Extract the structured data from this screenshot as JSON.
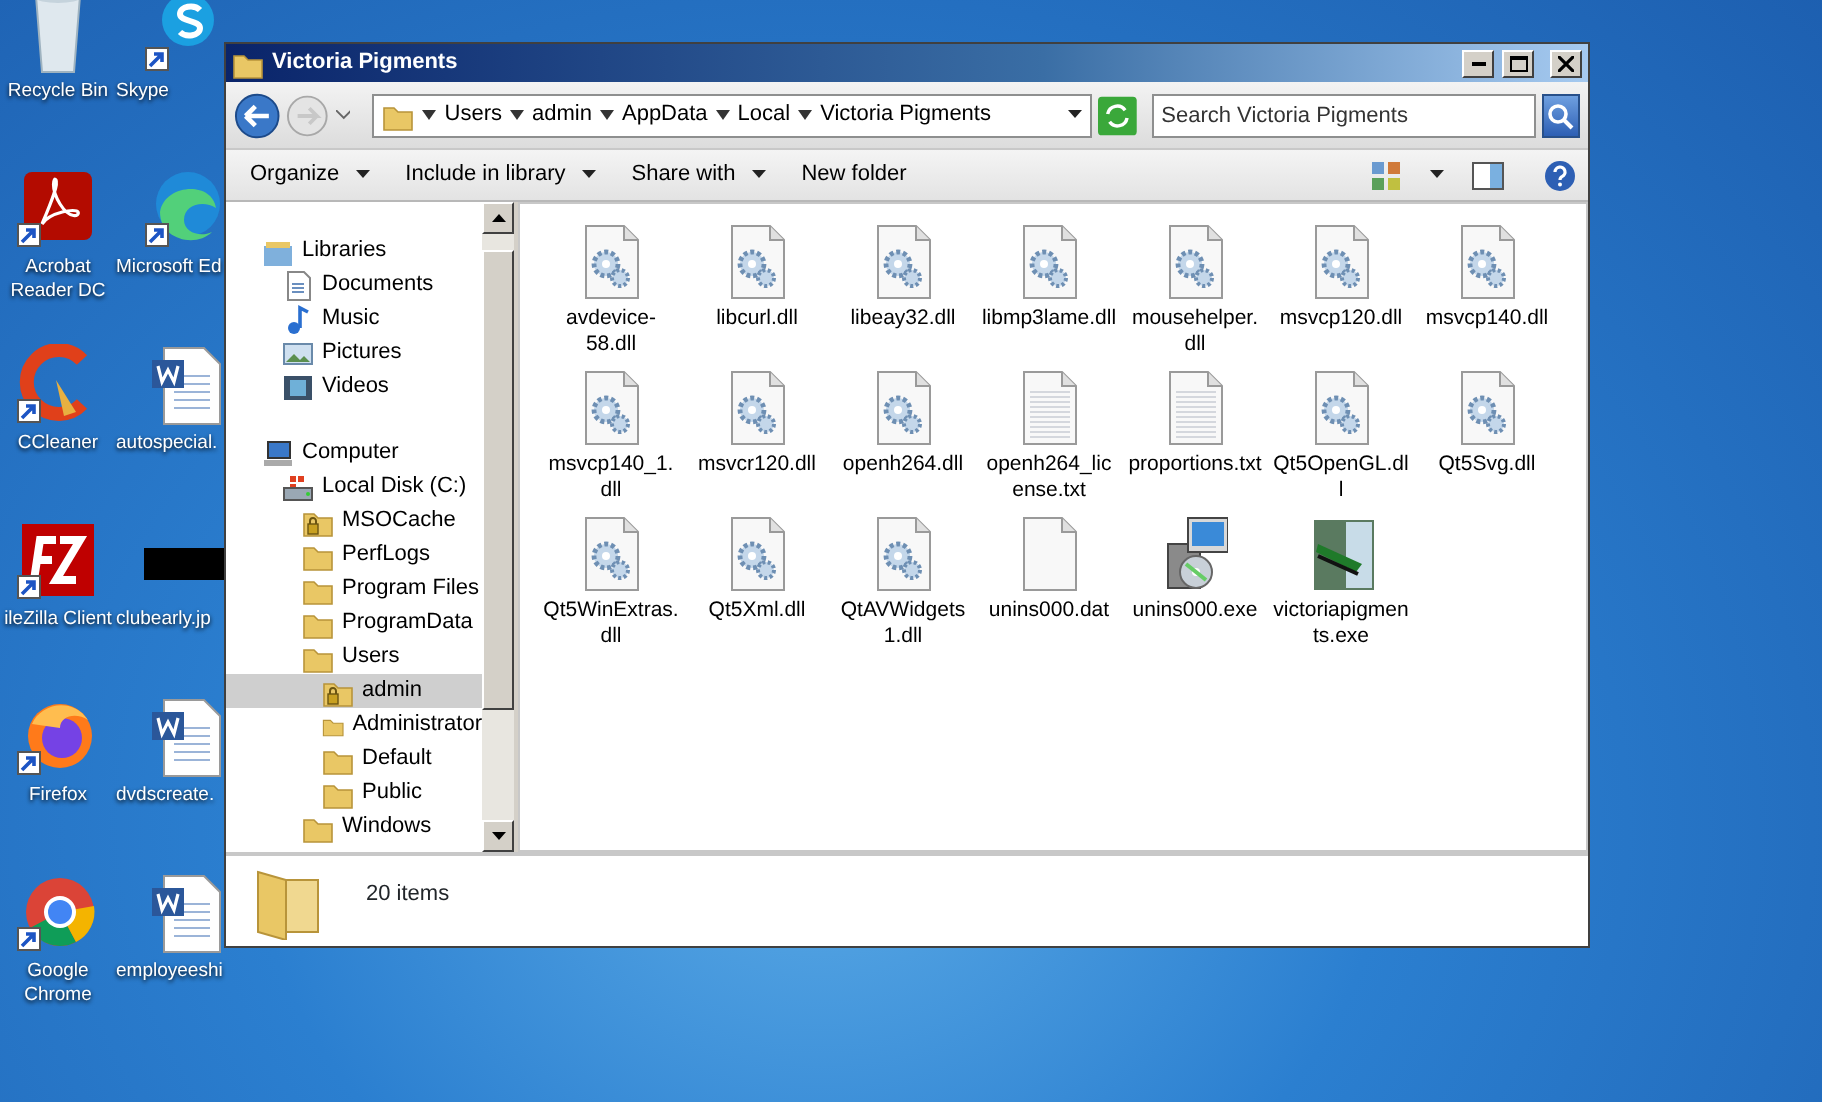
{
  "desktop": {
    "icons": [
      {
        "label": "Recycle Bin",
        "kind": "recycle",
        "shortcut": false
      },
      {
        "label": "Skype",
        "kind": "skype",
        "shortcut": true
      },
      {
        "label": "Acrobat Reader DC",
        "kind": "acrobat",
        "shortcut": true
      },
      {
        "label": "Microsoft Ed",
        "kind": "edge",
        "shortcut": true
      },
      {
        "label": "CCleaner",
        "kind": "ccleaner",
        "shortcut": true
      },
      {
        "label": "autospecial.",
        "kind": "word",
        "shortcut": false
      },
      {
        "label": "ileZilla Client",
        "kind": "filezilla",
        "shortcut": true
      },
      {
        "label": "clubearly.jp",
        "kind": "image",
        "shortcut": false
      },
      {
        "label": "Firefox",
        "kind": "firefox",
        "shortcut": true
      },
      {
        "label": "dvdscreate.",
        "kind": "word",
        "shortcut": false
      },
      {
        "label": "Google Chrome",
        "kind": "chrome",
        "shortcut": true
      },
      {
        "label": "employeeshi",
        "kind": "word",
        "shortcut": false
      }
    ]
  },
  "window": {
    "title": "Victoria Pigments",
    "breadcrumb": [
      "Users",
      "admin",
      "AppData",
      "Local",
      "Victoria Pigments"
    ],
    "search": {
      "placeholder": "Search Victoria Pigments"
    },
    "toolbar": [
      {
        "label": "Organize",
        "dropdown": true
      },
      {
        "label": "Include in library",
        "dropdown": true
      },
      {
        "label": "Share with",
        "dropdown": true
      },
      {
        "label": "New folder",
        "dropdown": false
      }
    ],
    "nav_tree": [
      {
        "label": "Libraries",
        "kind": "library",
        "selected": false,
        "children": [
          {
            "label": "Documents",
            "kind": "documents",
            "selected": false
          },
          {
            "label": "Music",
            "kind": "music",
            "selected": false
          },
          {
            "label": "Pictures",
            "kind": "pictures",
            "selected": false
          },
          {
            "label": "Videos",
            "kind": "videos",
            "selected": false
          }
        ]
      },
      {
        "label": "Computer",
        "kind": "computer",
        "selected": false,
        "children": [
          {
            "label": "Local Disk (C:)",
            "kind": "disk",
            "selected": false,
            "children": [
              {
                "label": "MSOCache",
                "kind": "locked-folder",
                "selected": false
              },
              {
                "label": "PerfLogs",
                "kind": "folder",
                "selected": false
              },
              {
                "label": "Program Files",
                "kind": "folder",
                "selected": false
              },
              {
                "label": "ProgramData",
                "kind": "folder",
                "selected": false
              },
              {
                "label": "Users",
                "kind": "folder",
                "selected": false,
                "children": [
                  {
                    "label": "admin",
                    "kind": "locked-folder",
                    "selected": true
                  },
                  {
                    "label": "Administrator",
                    "kind": "folder",
                    "selected": false
                  },
                  {
                    "label": "Default",
                    "kind": "folder",
                    "selected": false
                  },
                  {
                    "label": "Public",
                    "kind": "folder",
                    "selected": false
                  }
                ]
              },
              {
                "label": "Windows",
                "kind": "folder",
                "selected": false
              }
            ]
          }
        ]
      }
    ],
    "files": [
      {
        "name": "avdevice-58.dll",
        "kind": "dll"
      },
      {
        "name": "libcurl.dll",
        "kind": "dll"
      },
      {
        "name": "libeay32.dll",
        "kind": "dll"
      },
      {
        "name": "libmp3lame.dll",
        "kind": "dll"
      },
      {
        "name": "mousehelper.dll",
        "kind": "dll"
      },
      {
        "name": "msvcp120.dll",
        "kind": "dll"
      },
      {
        "name": "msvcp140.dll",
        "kind": "dll"
      },
      {
        "name": "msvcp140_1.dll",
        "kind": "dll"
      },
      {
        "name": "msvcr120.dll",
        "kind": "dll"
      },
      {
        "name": "openh264.dll",
        "kind": "dll"
      },
      {
        "name": "openh264_license.txt",
        "kind": "txt"
      },
      {
        "name": "proportions.txt",
        "kind": "txt"
      },
      {
        "name": "Qt5OpenGL.dll",
        "kind": "dll"
      },
      {
        "name": "Qt5Svg.dll",
        "kind": "dll"
      },
      {
        "name": "Qt5WinExtras.dll",
        "kind": "dll"
      },
      {
        "name": "Qt5Xml.dll",
        "kind": "dll"
      },
      {
        "name": "QtAVWidgets1.dll",
        "kind": "dll"
      },
      {
        "name": "unins000.dat",
        "kind": "dat"
      },
      {
        "name": "unins000.exe",
        "kind": "installer"
      },
      {
        "name": "victoriapigments.exe",
        "kind": "app"
      }
    ],
    "status": "20 items"
  }
}
